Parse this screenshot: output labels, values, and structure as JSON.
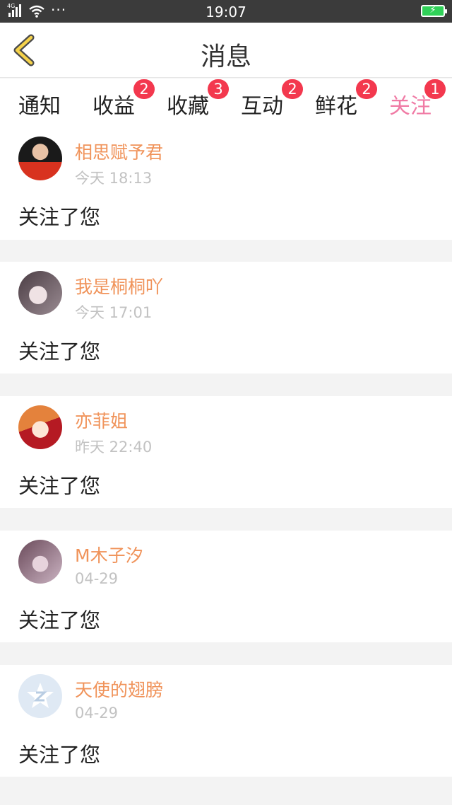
{
  "status_bar": {
    "network": "4G",
    "time": "19:07",
    "more": "···"
  },
  "header": {
    "title": "消息"
  },
  "tabs": [
    {
      "label": "通知"
    },
    {
      "label": "收益",
      "badge": "2"
    },
    {
      "label": "收藏",
      "badge": "3"
    },
    {
      "label": "互动",
      "badge": "2"
    },
    {
      "label": "鲜花",
      "badge": "2"
    },
    {
      "label": "关注",
      "badge": "1",
      "active": true
    }
  ],
  "messages": [
    {
      "name": "相思赋予君",
      "time": "今天 18:13",
      "text": "关注了您"
    },
    {
      "name": "我是桐桐吖",
      "time": "今天 17:01",
      "text": "关注了您"
    },
    {
      "name": "亦菲姐",
      "time": "昨天 22:40",
      "text": "关注了您"
    },
    {
      "name": "M木子汐",
      "time": "04-29",
      "text": "关注了您"
    },
    {
      "name": "天使的翅膀",
      "time": "04-29",
      "text": "关注了您"
    }
  ],
  "colors": {
    "accent": "#f07ba5",
    "name": "#f0935a",
    "badge": "#f3384e",
    "back_arrow": "#f5d24a",
    "status_bar": "#3b3b3b"
  },
  "icons": [
    "signal-icon",
    "wifi-icon",
    "battery-icon",
    "back-arrow-icon",
    "default-avatar-icon"
  ]
}
